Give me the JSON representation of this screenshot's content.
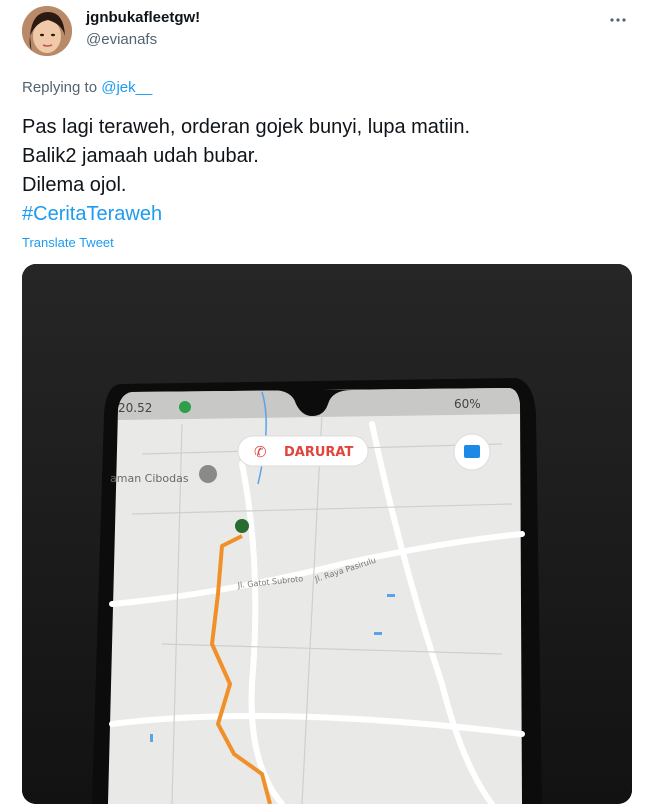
{
  "tweet": {
    "display_name": "jgnbukafleetgw!",
    "handle": "@evianafs",
    "reply_prefix": "Replying to",
    "reply_mention": "@jek__",
    "text_lines": [
      "Pas lagi teraweh, orderan gojek bunyi, lupa matiin.",
      "Balik2 jamaah udah bubar.",
      "Dilema ojol."
    ],
    "hashtag": "#CeritaTeraweh",
    "translate_label": "Translate Tweet"
  },
  "phone": {
    "status_time": "20.52",
    "battery": "60%",
    "emergency_label": "DARURAT",
    "place_label": "aman Cibodas",
    "road_label_1": "Jl. Gatot Subroto",
    "road_label_2": "Jl. Raya Pasirulu"
  },
  "colors": {
    "link": "#1d9bf0",
    "route": "#f0902a",
    "emergency": "#e0443b"
  }
}
